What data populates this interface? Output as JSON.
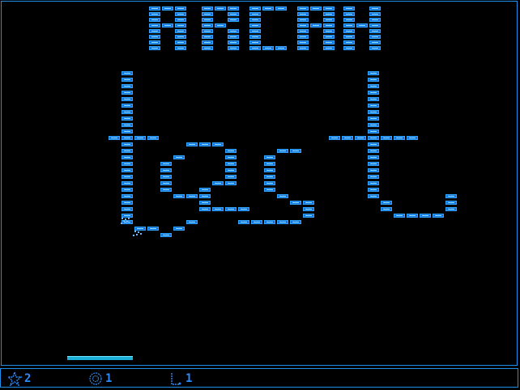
{
  "game": {
    "title_text": "ARCAN",
    "level_text": "test"
  },
  "status": {
    "lives_value": "2",
    "lives_icon": "star-icon",
    "bonus_value": "1",
    "bonus_icon": "ball-icon",
    "level_value": "1",
    "level_icon": "level-flag-icon"
  },
  "colors": {
    "background": "#000000",
    "border": "#1f8fe8",
    "brick": "#1a6fe0",
    "brick_highlight": "#8fe6ff",
    "paddle": "#1ab0d8",
    "hud_text": "#2b8cff"
  }
}
